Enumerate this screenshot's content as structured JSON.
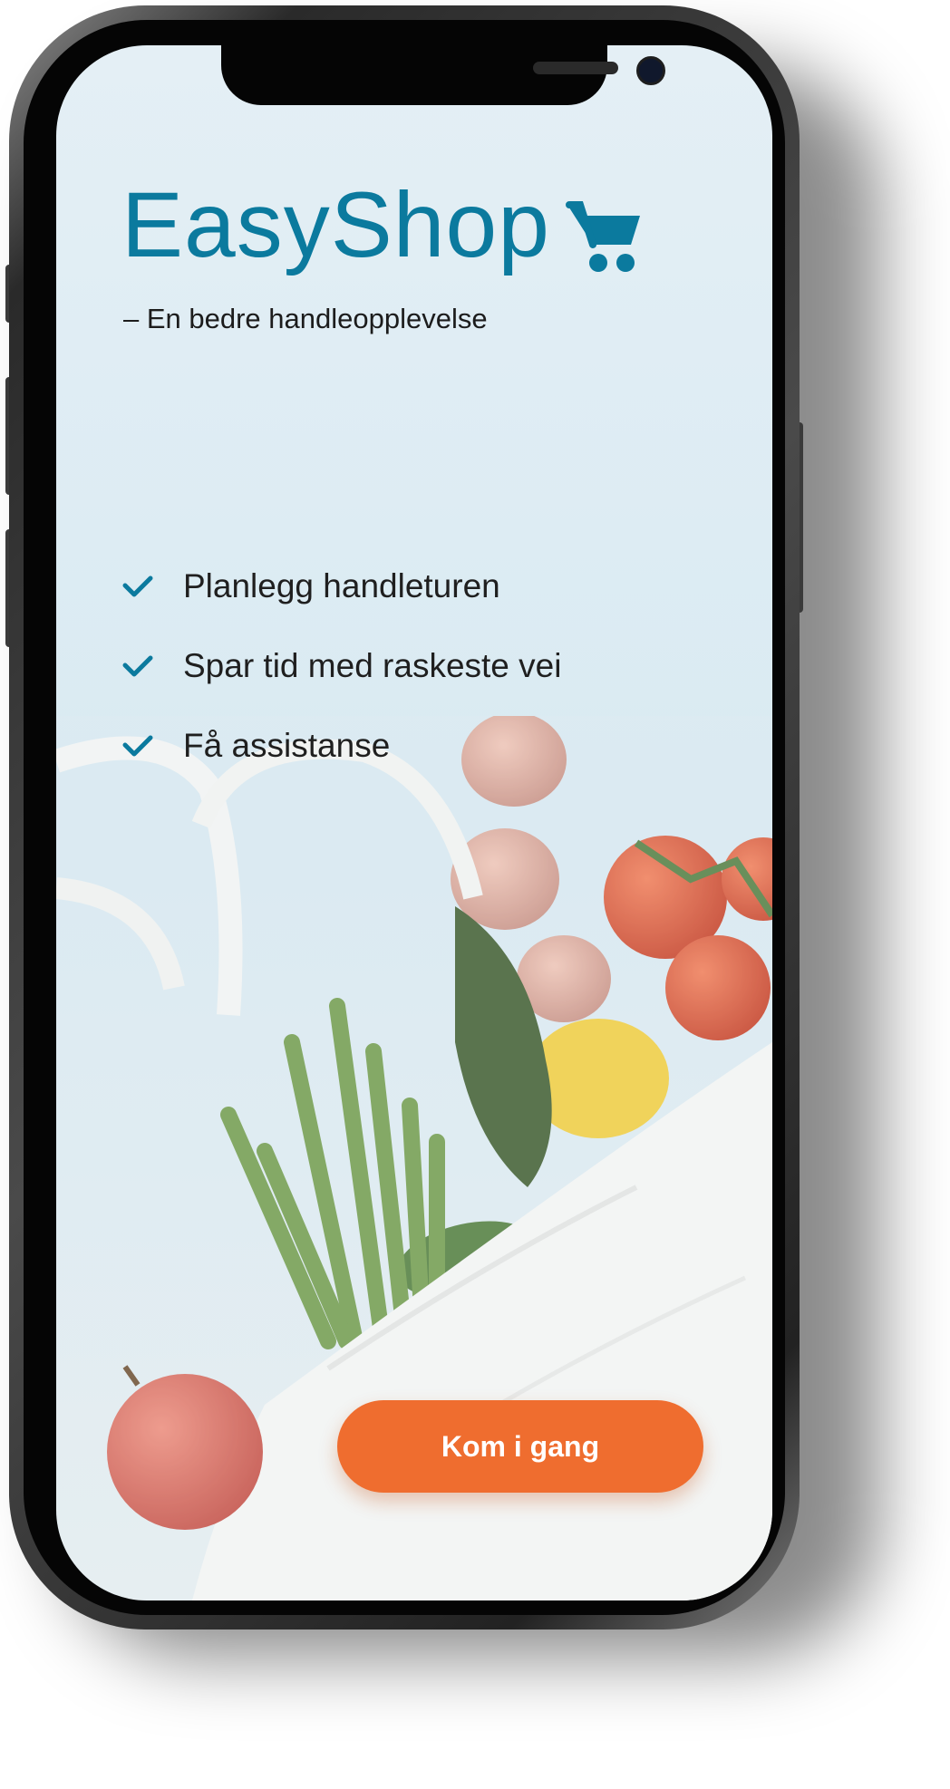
{
  "app": {
    "logo_text": "EasyShop",
    "tagline": "– En bedre handleopplevelse"
  },
  "features": [
    {
      "label": "Planlegg handleturen",
      "icon": "check-icon"
    },
    {
      "label": "Spar tid med raskeste vei",
      "icon": "check-icon"
    },
    {
      "label": "Få assistanse",
      "icon": "check-icon"
    }
  ],
  "cta": {
    "label": "Kom i gang"
  },
  "colors": {
    "brand": "#0b7a9e",
    "accent": "#ef6d2f",
    "background": "#e4eff5"
  }
}
